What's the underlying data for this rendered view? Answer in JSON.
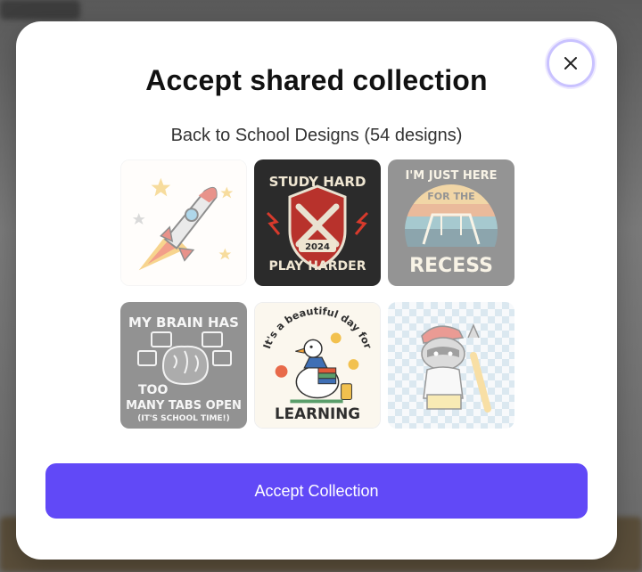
{
  "modal": {
    "title": "Accept shared collection",
    "subtitle": "Back to School Designs (54 designs)",
    "close_icon": "close-icon",
    "accept_label": "Accept Collection"
  },
  "designs": [
    {
      "name": "rocket-design",
      "text": ""
    },
    {
      "name": "study-hard-design",
      "line1": "STUDY HARD",
      "line2": "PLAY HARDER",
      "year": "2024"
    },
    {
      "name": "recess-design",
      "line1": "I'M JUST HERE",
      "line2": "FOR THE",
      "line3": "RECESS"
    },
    {
      "name": "brain-tabs-design",
      "line1": "MY BRAIN HAS",
      "line2": "TOO",
      "line3": "MANY TABS OPEN",
      "line4": "(IT'S SCHOOL TIME!)"
    },
    {
      "name": "goose-learning-design",
      "line1": "It's a beautiful day for",
      "line2": "LEARNING"
    },
    {
      "name": "raccoon-design",
      "text": ""
    }
  ],
  "colors": {
    "accent": "#6149f7",
    "close_ring": "#c9c2ff"
  }
}
